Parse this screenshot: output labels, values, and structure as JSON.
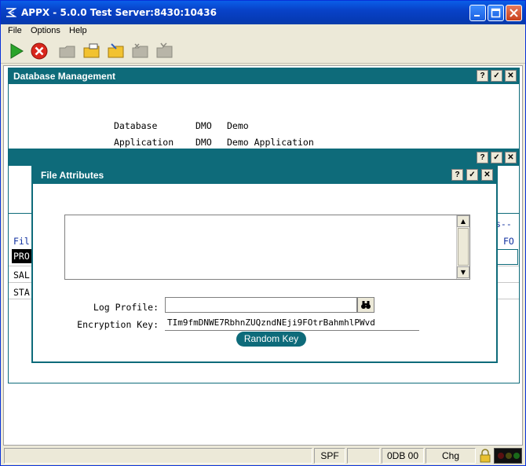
{
  "window": {
    "title": "APPX - 5.0.0 Test Server:8430:10436"
  },
  "menu": {
    "file": "File",
    "options": "Options",
    "help": "Help"
  },
  "toolbar": {
    "icons": [
      "run-icon",
      "stop-icon",
      "folder-disabled-icon",
      "folder-open-icon",
      "folder-edit-icon",
      "folder-delete-icon",
      "folder-inbox-icon"
    ]
  },
  "db_window": {
    "title": "Database Management",
    "database_label": "Database",
    "database_code": "DMO",
    "database_name": "Demo",
    "application_label": "Application",
    "application_code": "DMO",
    "application_name": "Demo Application"
  },
  "background_list": {
    "col_left_fragment": "Fil",
    "col_right_fragment": "FO",
    "dashes_fragment": "s--",
    "rows": [
      "PRO",
      "SAL",
      "STA"
    ]
  },
  "dialog": {
    "title": "File Attributes",
    "log_profile_label": "Log Profile:",
    "log_profile_value": "",
    "encryption_key_label": "Encryption Key:",
    "encryption_key_value": "TIm9fmDNWE7RbhnZUQzndNEji9FOtrBahmhlPWvd",
    "random_key_button": "Random Key"
  },
  "titlebar_buttons": {
    "help": "?",
    "ok": "✓",
    "close": "✕"
  },
  "statusbar": {
    "spf": "SPF",
    "db": "0DB 00",
    "mode": "Chg"
  },
  "colors": {
    "panel_teal": "#0e6b7a",
    "xp_blue": "#0842c8"
  }
}
